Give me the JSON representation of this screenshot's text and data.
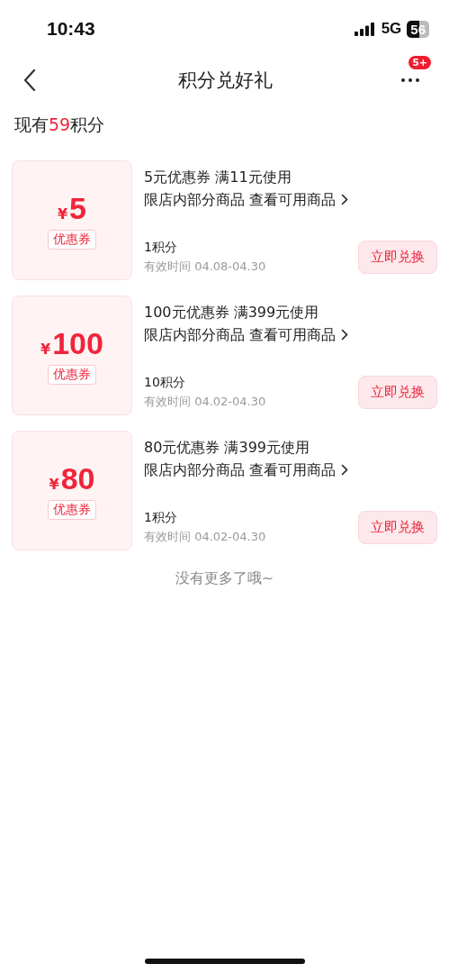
{
  "status_bar": {
    "time": "10:43",
    "network": "5G",
    "battery": "56"
  },
  "nav": {
    "title": "积分兑好礼",
    "badge": "5+"
  },
  "points": {
    "prefix": "现有",
    "value": "59",
    "suffix": "积分"
  },
  "coupons": [
    {
      "currency": "¥",
      "amount": "5",
      "tag": "优惠券",
      "title": "5元优惠券 满11元使用",
      "scope": "限店内部分商品 查看可用商品",
      "cost": "1积分",
      "validity": "有效时间 04.08-04.30",
      "action": "立即兑换"
    },
    {
      "currency": "¥",
      "amount": "100",
      "tag": "优惠券",
      "title": "100元优惠券 满399元使用",
      "scope": "限店内部分商品 查看可用商品",
      "cost": "10积分",
      "validity": "有效时间 04.02-04.30",
      "action": "立即兑换"
    },
    {
      "currency": "¥",
      "amount": "80",
      "tag": "优惠券",
      "title": "80元优惠券 满399元使用",
      "scope": "限店内部分商品 查看可用商品",
      "cost": "1积分",
      "validity": "有效时间 04.02-04.30",
      "action": "立即兑换"
    }
  ],
  "end_note": "没有更多了哦~"
}
